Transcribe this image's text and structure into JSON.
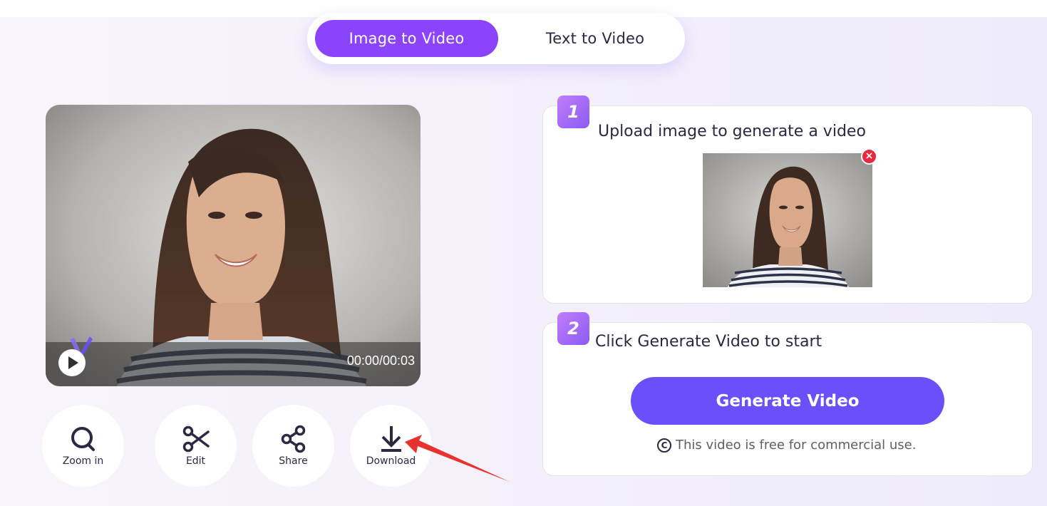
{
  "tabs": [
    {
      "label": "Image to Video",
      "active": true
    },
    {
      "label": "Text to Video",
      "active": false
    }
  ],
  "player": {
    "time": "00:00/00:03",
    "play_icon": "play-icon",
    "watermark_icon": "brand-logo-icon"
  },
  "actions": [
    {
      "label": "Zoom in",
      "icon": "search-icon"
    },
    {
      "label": "Edit",
      "icon": "scissors-icon"
    },
    {
      "label": "Share",
      "icon": "share-icon"
    },
    {
      "label": "Download",
      "icon": "download-icon"
    }
  ],
  "steps": [
    {
      "number": "1",
      "title": "Upload image to generate a video",
      "remove_icon": "close-icon"
    },
    {
      "number": "2",
      "title": "Click Generate Video to start"
    }
  ],
  "generate": {
    "label": "Generate Video",
    "license_text": "This video is free for commercial use.",
    "license_icon": "copyright-icon"
  },
  "colors": {
    "accent_tab": "#8b44fb",
    "generate_button": "#6a4ffa",
    "remove_badge": "#e5293f",
    "annotation_arrow": "#e8322f"
  }
}
